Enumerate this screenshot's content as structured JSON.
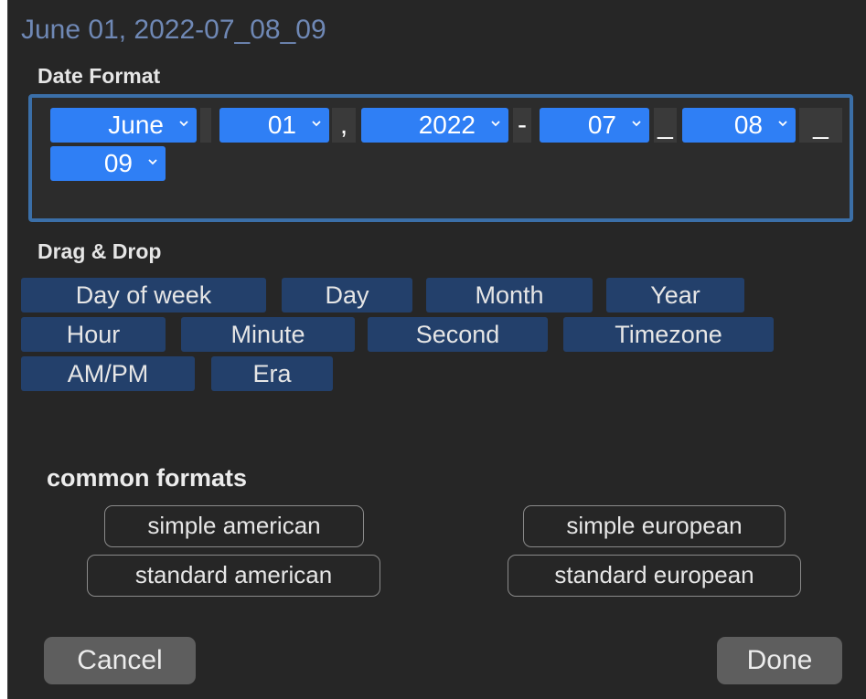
{
  "dialog": {
    "preview": "June 01, 2022-07_08_09"
  },
  "date_format": {
    "label": "Date Format",
    "tokens": [
      {
        "value": "June",
        "icon": "chevron-down-icon"
      },
      {
        "value": "01",
        "icon": "chevron-down-icon"
      },
      {
        "value": "2022",
        "icon": "chevron-down-icon"
      },
      {
        "value": "07",
        "icon": "chevron-down-icon"
      },
      {
        "value": "08",
        "icon": "chevron-down-icon"
      },
      {
        "value": "09",
        "icon": "chevron-down-icon"
      }
    ],
    "separators": [
      "",
      ",",
      "-",
      "_",
      "_"
    ]
  },
  "drag_drop": {
    "label": "Drag & Drop",
    "items": [
      "Day of week",
      "Day",
      "Month",
      "Year",
      "Hour",
      "Minute",
      "Second",
      "Timezone",
      "AM/PM",
      "Era"
    ]
  },
  "common_formats": {
    "label": "common formats",
    "simple_american": "simple american",
    "simple_european": "simple european",
    "standard_american": "standard american",
    "standard_european": "standard european"
  },
  "actions": {
    "cancel": "Cancel",
    "done": "Done"
  },
  "colors": {
    "token_bg": "#2f7ff5",
    "dnd_bg": "#23406b",
    "dialog_bg": "#262626",
    "focus_border": "#3b6fa8"
  }
}
